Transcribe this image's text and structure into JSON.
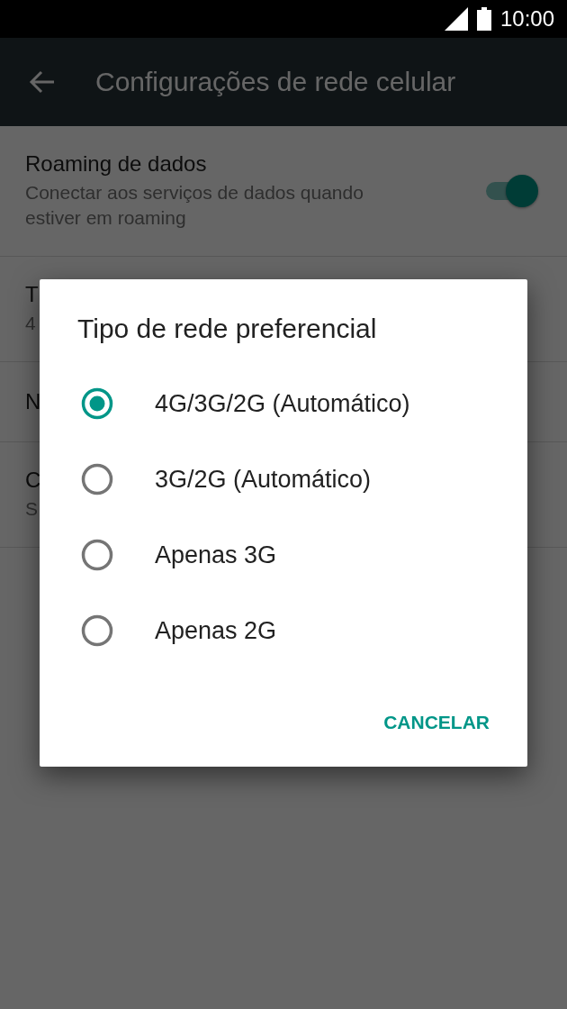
{
  "status_bar": {
    "time": "10:00"
  },
  "toolbar": {
    "title": "Configurações de rede celular"
  },
  "settings": [
    {
      "kind": "switch",
      "title": "Roaming de dados",
      "subtitle": "Conectar aos serviços de dados quando estiver em roaming",
      "on": true
    },
    {
      "kind": "text",
      "title": "T",
      "subtitle": "4"
    },
    {
      "kind": "text",
      "title": "N"
    },
    {
      "kind": "text",
      "title": "C",
      "subtitle": "S"
    }
  ],
  "dialog": {
    "title": "Tipo de rede preferencial",
    "options": [
      {
        "label": "4G/3G/2G (Automático)",
        "selected": true
      },
      {
        "label": "3G/2G (Automático)",
        "selected": false
      },
      {
        "label": "Apenas 3G",
        "selected": false
      },
      {
        "label": "Apenas 2G",
        "selected": false
      }
    ],
    "buttons": [
      "CANCELAR"
    ]
  }
}
